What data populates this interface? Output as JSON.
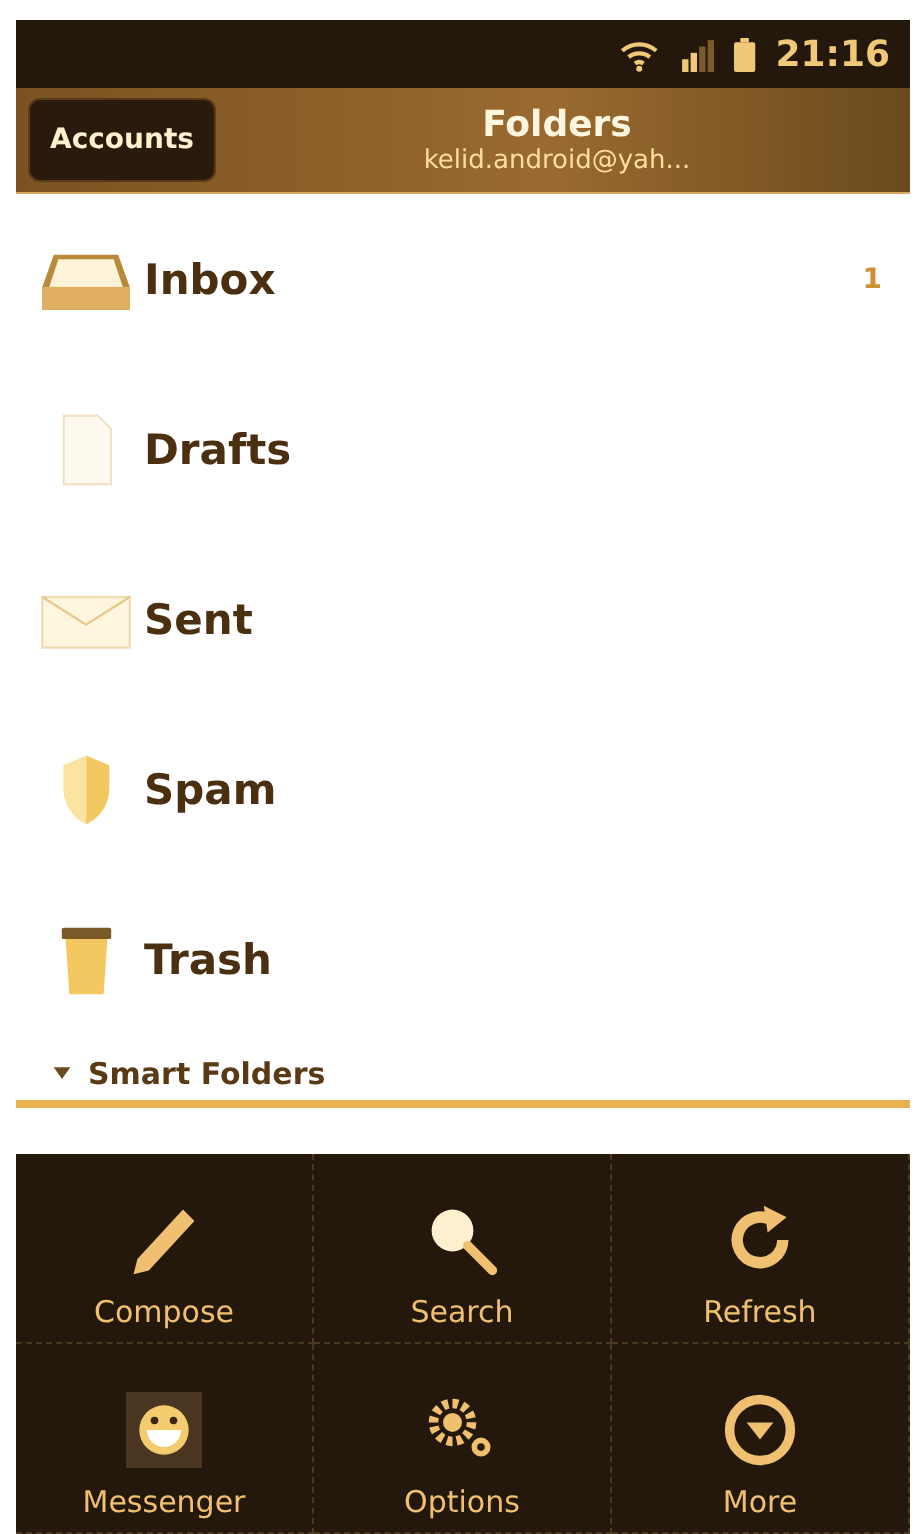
{
  "status_bar": {
    "time": "21:16"
  },
  "header": {
    "accounts_button": "Accounts",
    "title": "Folders",
    "account": "kelid.android@yah..."
  },
  "folders": [
    {
      "name": "Inbox",
      "count": "1"
    },
    {
      "name": "Drafts"
    },
    {
      "name": "Sent"
    },
    {
      "name": "Spam"
    },
    {
      "name": "Trash"
    }
  ],
  "section": {
    "label": "Smart Folders",
    "expanded": true
  },
  "menu": [
    {
      "label": "Compose"
    },
    {
      "label": "Search"
    },
    {
      "label": "Refresh"
    },
    {
      "label": "Messenger"
    },
    {
      "label": "Options"
    },
    {
      "label": "More"
    }
  ]
}
